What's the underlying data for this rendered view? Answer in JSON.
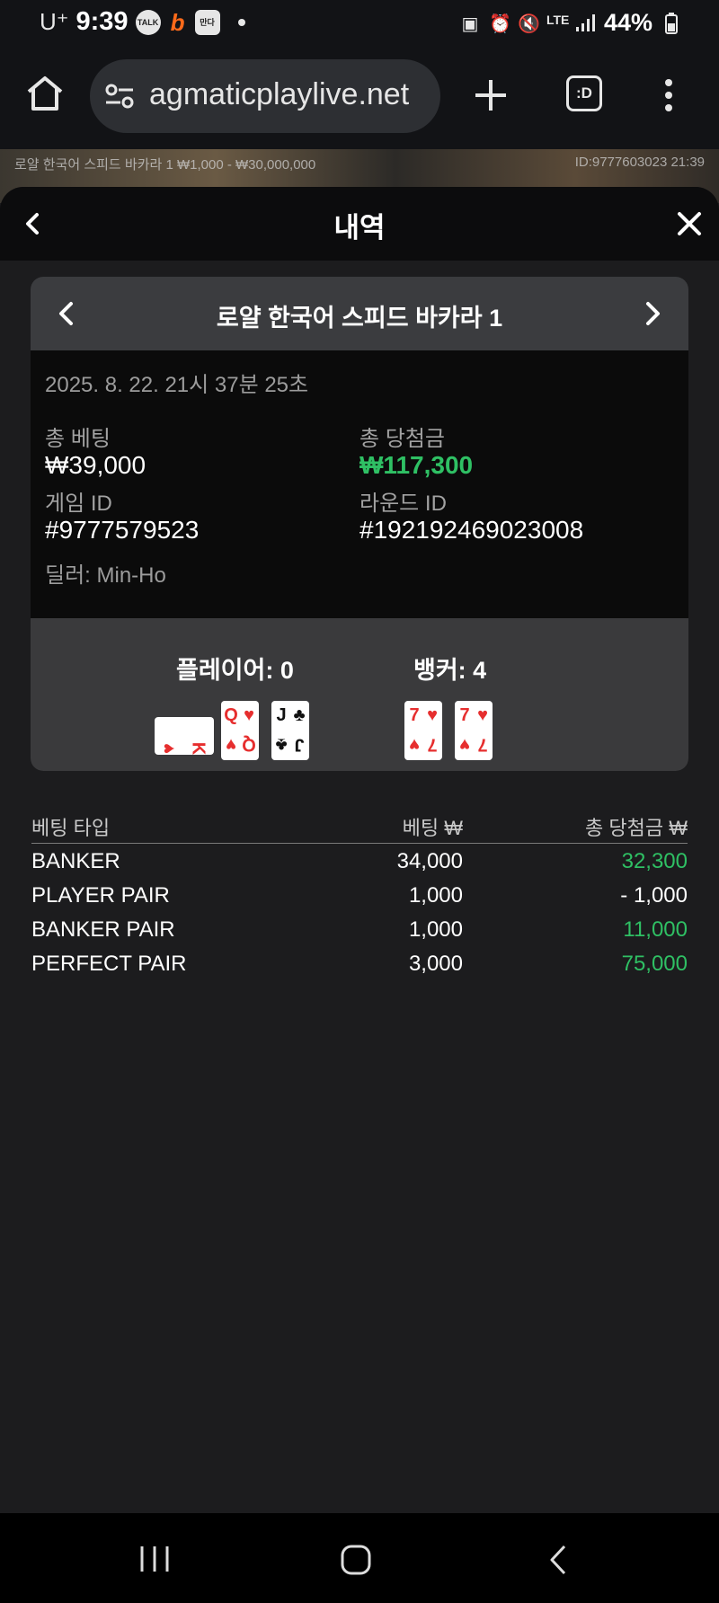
{
  "status": {
    "carrier": "U⁺",
    "time": "9:39",
    "talk_icon_text": "TALK",
    "b_icon_text": "b",
    "app_icon_text": "만다",
    "battery_pct": "44%",
    "lte_text": "LTE"
  },
  "browser": {
    "url": "agmaticplaylive.net",
    "tab_label": ":D"
  },
  "background_game": {
    "title_text": "로얄 한국어 스피드 바카라 1  ₩1,000 - ₩30,000,000",
    "id_text": "ID:9777603023  21:39"
  },
  "sheet": {
    "title": "내역"
  },
  "round": {
    "game_name": "로얄 한국어 스피드 바카라 1",
    "datetime": "2025. 8. 22. 21시 37분 25초",
    "total_bet_label": "총 베팅",
    "total_bet_value": "₩39,000",
    "total_win_label": "총 당첨금",
    "total_win_value": "₩117,300",
    "game_id_label": "게임 ID",
    "game_id_value": "#9777579523",
    "round_id_label": "라운드 ID",
    "round_id_value": "#192192469023008",
    "dealer": "딜러: Min-Ho"
  },
  "result": {
    "player_label": "플레이어: 0",
    "banker_label": "뱅커: 4",
    "player_cards": [
      {
        "rank": "K",
        "suit": "♥",
        "color": "#e62e2e",
        "sideways": true
      },
      {
        "rank": "Q",
        "suit": "♥",
        "color": "#e62e2e",
        "sideways": false
      },
      {
        "rank": "J",
        "suit": "♣",
        "color": "#111111",
        "sideways": false
      }
    ],
    "banker_cards": [
      {
        "rank": "7",
        "suit": "♥",
        "color": "#e62e2e",
        "sideways": false
      },
      {
        "rank": "7",
        "suit": "♥",
        "color": "#e62e2e",
        "sideways": false
      }
    ]
  },
  "bets": {
    "headers": [
      "베팅 타입",
      "베팅 ₩",
      "총 당첨금 ₩"
    ],
    "rows": [
      {
        "type": "BANKER",
        "bet": "34,000",
        "win": "32,300",
        "positive": true
      },
      {
        "type": "PLAYER PAIR",
        "bet": "1,000",
        "win": "- 1,000",
        "positive": false
      },
      {
        "type": "BANKER PAIR",
        "bet": "1,000",
        "win": "11,000",
        "positive": true
      },
      {
        "type": "PERFECT PAIR",
        "bet": "3,000",
        "win": "75,000",
        "positive": true
      }
    ]
  },
  "colors": {
    "win_green": "#2fc064",
    "suit_red": "#e62e2e",
    "card_header": "#3b3c3f",
    "result_bg": "#3a3a3c"
  }
}
